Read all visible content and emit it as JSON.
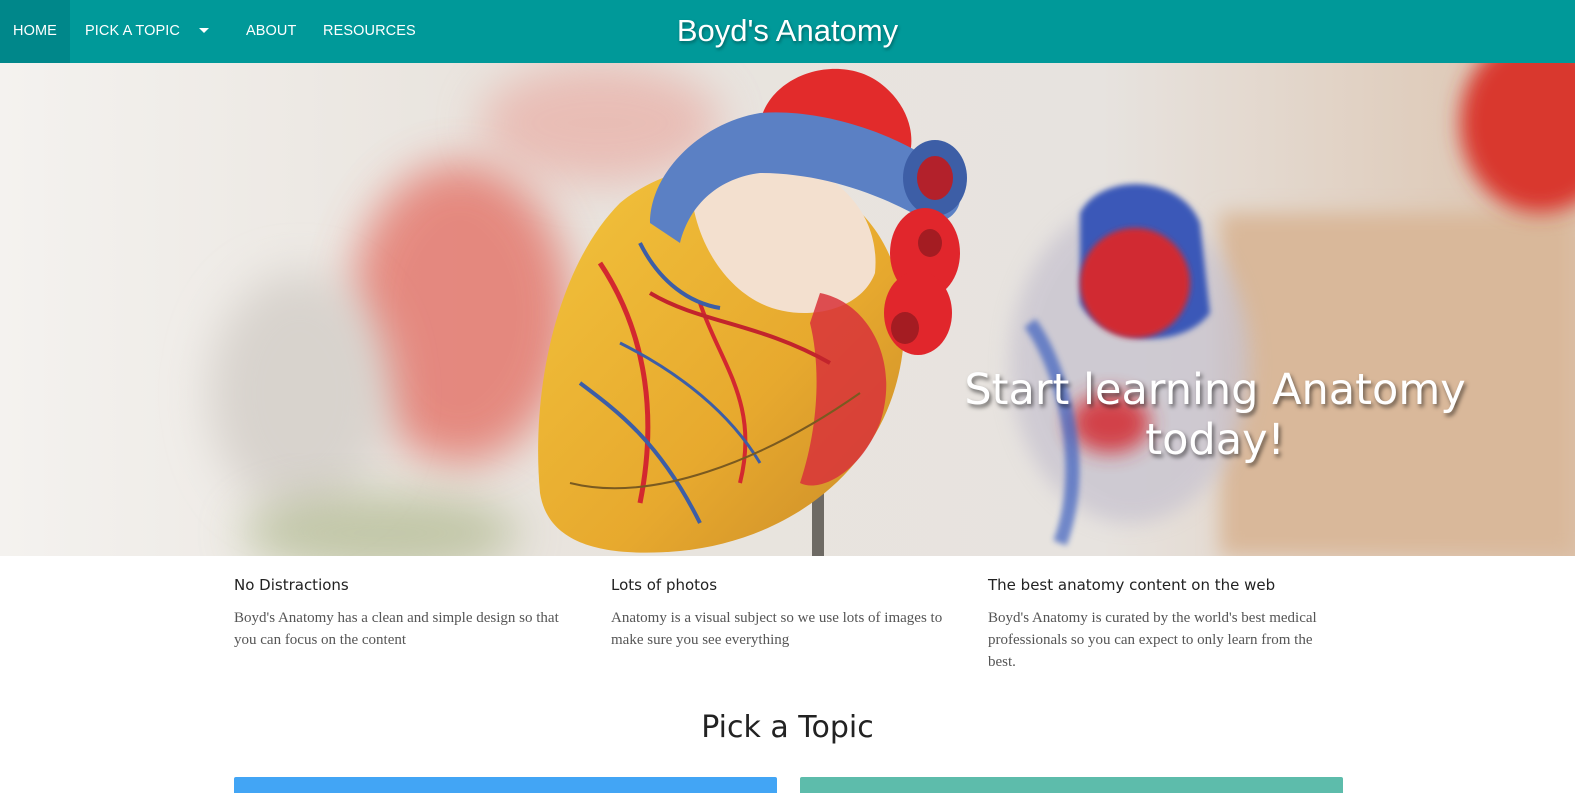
{
  "nav": {
    "items": [
      {
        "label": "HOME",
        "active": true
      },
      {
        "label": "PICK A TOPIC",
        "has_dropdown": true
      },
      {
        "label": "ABOUT"
      },
      {
        "label": "RESOURCES"
      }
    ],
    "brand": "Boyd's Anatomy",
    "color": "#009999",
    "active_color": "#00878a"
  },
  "hero": {
    "title": "Start learning Anatomy today!",
    "image_alt": "Anatomical heart model"
  },
  "features": [
    {
      "title": "No Distractions",
      "text": "Boyd's Anatomy has a clean and simple design so that you can focus on the content"
    },
    {
      "title": "Lots of photos",
      "text": "Anatomy is a visual subject so we use lots of images to make sure you see everything"
    },
    {
      "title": "The best anatomy content on the web",
      "text": "Boyd's Anatomy is curated by the world's best medical professionals so you can expect to only learn from the best."
    }
  ],
  "topics_section": {
    "title": "Pick a Topic",
    "card_colors": [
      "#42a5f5",
      "#5dbcab"
    ]
  }
}
